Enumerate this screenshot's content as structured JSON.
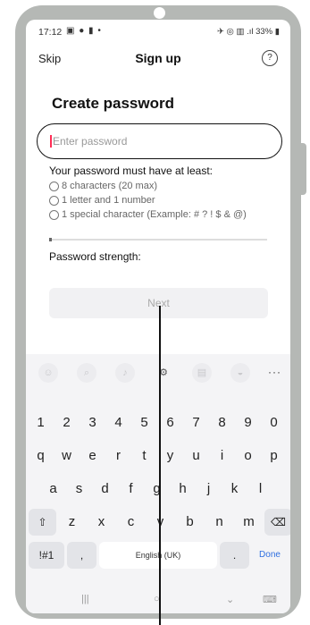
{
  "status_bar": {
    "time": "17:12",
    "left_icons": "▣ ● ▮ •",
    "right": "✈ ◎ ▥ .ıl 33% ▮"
  },
  "header": {
    "skip": "Skip",
    "title": "Sign up",
    "help_icon": "?"
  },
  "form": {
    "heading": "Create password",
    "password_placeholder": "Enter password",
    "password_value": "",
    "rules_heading": "Your password must have at least:",
    "rules": [
      "8 characters (20 max)",
      "1 letter and 1 number",
      "1 special character (Example: # ? ! $ & @)"
    ],
    "strength_label": "Password strength:",
    "strength_level": 0,
    "next_button": "Next"
  },
  "keyboard": {
    "toolbar_icons": [
      "emoji-icon",
      "search-icon",
      "mic-icon",
      "settings-icon",
      "clipboard-icon",
      "sticker-icon"
    ],
    "more": "···",
    "rows": [
      [
        "1",
        "2",
        "3",
        "4",
        "5",
        "6",
        "7",
        "8",
        "9",
        "0"
      ],
      [
        "q",
        "w",
        "e",
        "r",
        "t",
        "y",
        "u",
        "i",
        "o",
        "p"
      ],
      [
        "a",
        "s",
        "d",
        "f",
        "g",
        "h",
        "j",
        "k",
        "l"
      ],
      [
        "⇧",
        "z",
        "x",
        "c",
        "v",
        "b",
        "n",
        "m",
        "⌫"
      ],
      [
        "!#1",
        ",",
        "English (UK)",
        ".",
        "Done"
      ]
    ]
  },
  "nav_bar": {
    "recents": "|||",
    "home": "○",
    "back": "⌄",
    "keyboard": "⌨"
  }
}
